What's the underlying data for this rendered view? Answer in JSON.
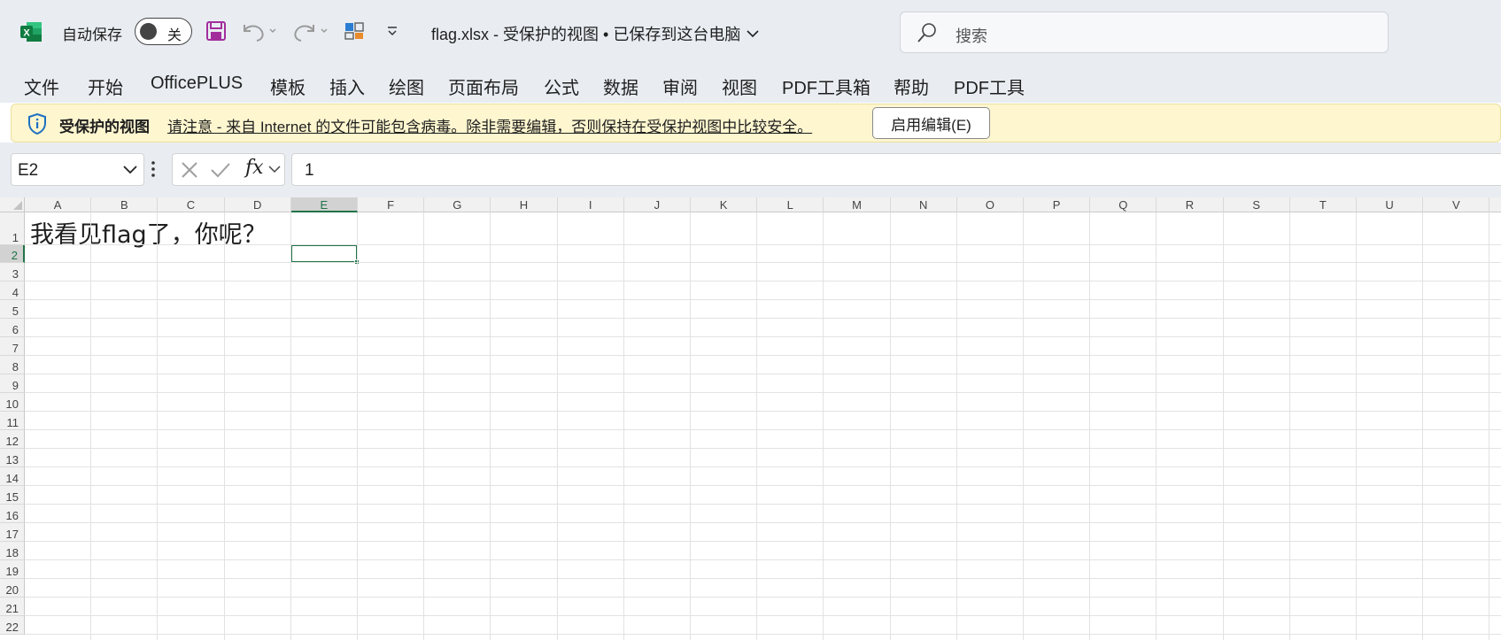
{
  "titlebar": {
    "autosave_label": "自动保存",
    "autosave_state": "关",
    "document_title": "flag.xlsx  -  受保护的视图 • 已保存到这台电脑",
    "search_placeholder": "搜索"
  },
  "ribbon_tabs": [
    "文件",
    "开始",
    "OfficePLUS",
    "模板",
    "插入",
    "绘图",
    "页面布局",
    "公式",
    "数据",
    "审阅",
    "视图",
    "PDF工具箱",
    "帮助",
    "PDF工具"
  ],
  "banner": {
    "title": "受保护的视图",
    "message": "请注意 - 来自 Internet 的文件可能包含病毒。除非需要编辑，否则保持在受保护视图中比较安全。",
    "button": "启用编辑(E)"
  },
  "formula_bar": {
    "name_box": "E2",
    "fx_label": "fx",
    "formula": "1"
  },
  "sheet": {
    "columns": [
      "A",
      "B",
      "C",
      "D",
      "E",
      "F",
      "G",
      "H",
      "I",
      "J",
      "K",
      "L",
      "M",
      "N",
      "O",
      "P",
      "Q",
      "R",
      "S",
      "T",
      "U",
      "V"
    ],
    "selected_column": "E",
    "rows": [
      "1",
      "2",
      "3",
      "4",
      "5",
      "6",
      "7",
      "8",
      "9",
      "10",
      "11",
      "12",
      "13",
      "14",
      "15",
      "16",
      "17",
      "18",
      "19",
      "20",
      "21",
      "22"
    ],
    "selected_row": "2",
    "a1_text": "我看见flag了，你呢？"
  },
  "colors": {
    "excel_green": "#217346",
    "banner_bg": "#fdf6cf",
    "chrome_bg": "#e9edf2"
  }
}
